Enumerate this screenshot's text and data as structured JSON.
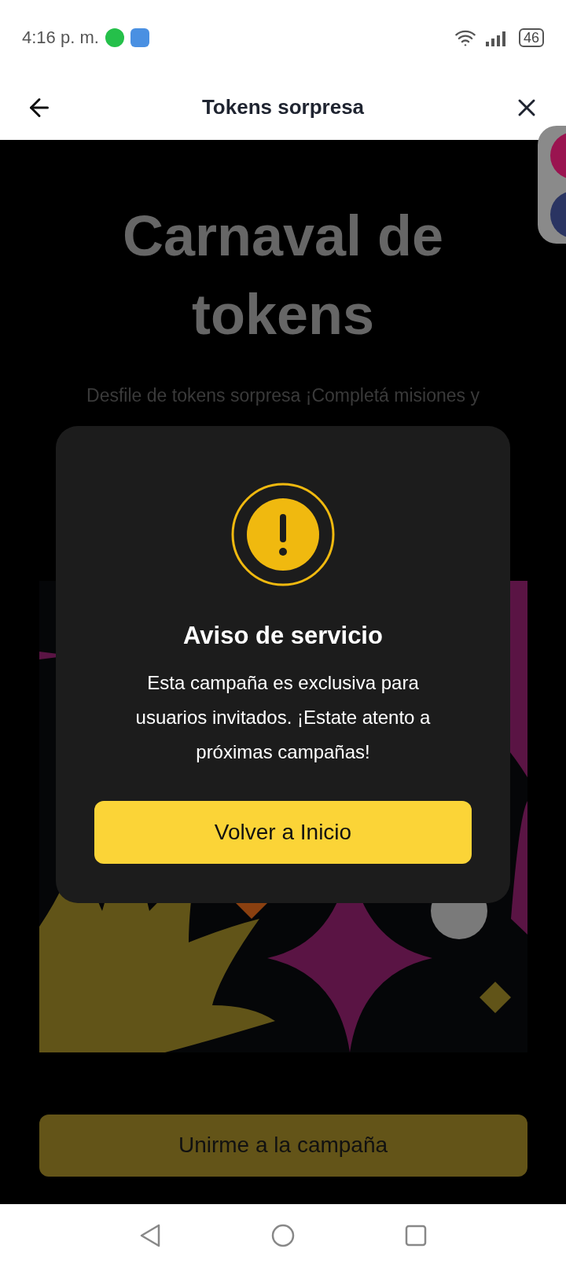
{
  "status_bar": {
    "time": "4:16 p. m.",
    "battery": "46"
  },
  "header": {
    "title": "Tokens sorpresa"
  },
  "campaign": {
    "title": "Carnaval de tokens",
    "subtitle": "Desfile de tokens sorpresa ¡Completá misiones y",
    "join_button": "Unirme a la campaña"
  },
  "dialog": {
    "title": "Aviso de servicio",
    "message": "Esta campaña es exclusiva para usuarios invitados. ¡Estate atento a próximas campañas!",
    "button": "Volver a Inicio"
  }
}
